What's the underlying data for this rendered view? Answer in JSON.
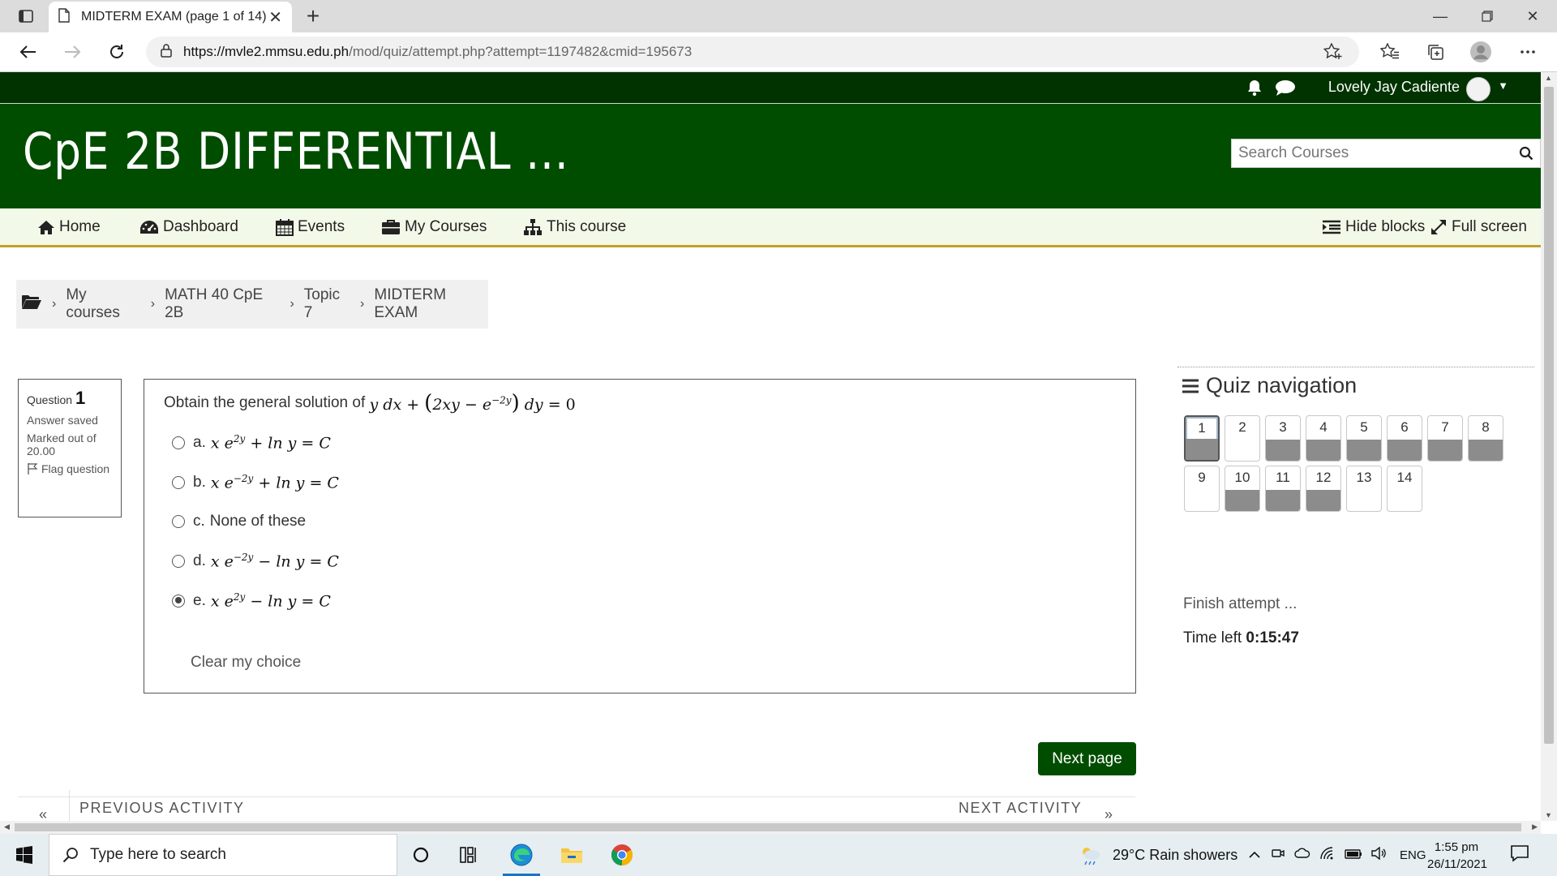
{
  "browser": {
    "tab_title": "MIDTERM EXAM (page 1 of 14)",
    "url_host": "https://mvle2.mmsu.edu.ph",
    "url_path": "/mod/quiz/attempt.php?attempt=1197482&cmid=195673"
  },
  "topbar": {
    "user_name": "Lovely Jay Cadiente"
  },
  "header": {
    "site_title": "CpE 2B DIFFERENTIAL ...",
    "search_placeholder": "Search Courses"
  },
  "nav": {
    "home": "Home",
    "dashboard": "Dashboard",
    "events": "Events",
    "my_courses": "My Courses",
    "this_course": "This course",
    "hide_blocks": "Hide blocks",
    "full_screen": "Full screen"
  },
  "breadcrumb": [
    "My courses",
    "MATH 40 CpE 2B",
    "Topic 7",
    "MIDTERM EXAM"
  ],
  "question_info": {
    "label": "Question",
    "number": "1",
    "state": "Answer saved",
    "marked": "Marked out of 20.00",
    "flag": "Flag question"
  },
  "question": {
    "prompt": "Obtain the general solution of",
    "options": [
      {
        "letter": "a.",
        "selected": false
      },
      {
        "letter": "b.",
        "selected": false
      },
      {
        "letter": "c.",
        "text": "None of these",
        "selected": false
      },
      {
        "letter": "d.",
        "selected": false
      },
      {
        "letter": "e.",
        "selected": true
      }
    ],
    "clear_choice": "Clear my choice"
  },
  "actions": {
    "next_page": "Next page",
    "previous_activity": "PREVIOUS ACTIVITY",
    "next_activity": "NEXT ACTIVITY"
  },
  "quiz_nav": {
    "title": "Quiz navigation",
    "questions": [
      {
        "n": "1",
        "answered": true,
        "current": true
      },
      {
        "n": "2",
        "answered": false
      },
      {
        "n": "3",
        "answered": true
      },
      {
        "n": "4",
        "answered": true
      },
      {
        "n": "5",
        "answered": true
      },
      {
        "n": "6",
        "answered": true
      },
      {
        "n": "7",
        "answered": true
      },
      {
        "n": "8",
        "answered": true
      },
      {
        "n": "9",
        "answered": false
      },
      {
        "n": "10",
        "answered": true
      },
      {
        "n": "11",
        "answered": true
      },
      {
        "n": "12",
        "answered": true
      },
      {
        "n": "13",
        "answered": false
      },
      {
        "n": "14",
        "answered": false
      }
    ],
    "finish_attempt": "Finish attempt ...",
    "time_left_label": "Time left",
    "time_left_value": "0:15:47"
  },
  "taskbar": {
    "search_placeholder": "Type here to search",
    "weather": "29°C  Rain showers",
    "language": "ENG",
    "time": "1:55 pm",
    "date": "26/11/2021"
  },
  "colors": {
    "topbar": "#003300",
    "header": "#004d00",
    "navbar_bg": "#f3f9e9",
    "navbar_border": "#c4a02c",
    "answered_fill": "#8c8c8c"
  },
  "icons": [
    "tab-actions-icon",
    "page-icon",
    "close-icon",
    "plus-icon",
    "back-icon",
    "forward-icon",
    "refresh-icon",
    "lock-icon",
    "add-favorite-icon",
    "favorites-icon",
    "collections-icon",
    "profile-icon",
    "more-icon",
    "bell-icon",
    "chat-icon",
    "search-icon",
    "home-icon",
    "dashboard-icon",
    "calendar-icon",
    "briefcase-icon",
    "sitemap-icon",
    "hide-blocks-icon",
    "expand-icon",
    "folder-icon",
    "flag-icon",
    "hamburger-icon",
    "windows-icon",
    "cortana-icon",
    "task-view-icon",
    "edge-icon",
    "file-explorer-icon",
    "chrome-icon",
    "weather-icon"
  ]
}
